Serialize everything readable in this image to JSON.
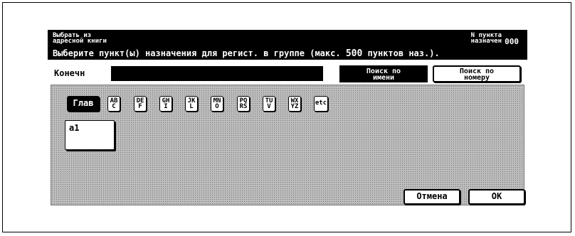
{
  "header": {
    "title_line1": "Выбрать из",
    "title_line2": "адресной книги",
    "count_line1": "N пункта",
    "count_line2": "назначен",
    "count_value": "000",
    "message_prefix": "Выберите пункт(ы) назначения для регист. в группе (макс. ",
    "message_max": "500",
    "message_suffix": " пунктов наз.)."
  },
  "destination": {
    "label": "Конечн",
    "value": ""
  },
  "search": {
    "by_name_line1": "Поиск по",
    "by_name_line2": "имени",
    "by_number_line1": "Поиск по",
    "by_number_line2": "номеру"
  },
  "index_tabs": [
    {
      "line1": "Глав",
      "line2": ""
    },
    {
      "line1": "AB",
      "line2": "C"
    },
    {
      "line1": "DE",
      "line2": "F"
    },
    {
      "line1": "GH",
      "line2": "I"
    },
    {
      "line1": "JK",
      "line2": "L"
    },
    {
      "line1": "MN",
      "line2": "O"
    },
    {
      "line1": "PQ",
      "line2": "RS"
    },
    {
      "line1": "TU",
      "line2": "V"
    },
    {
      "line1": "WX",
      "line2": "YZ"
    },
    {
      "line1": "etc",
      "line2": ""
    }
  ],
  "entries": [
    {
      "label": "a1"
    }
  ],
  "actions": {
    "cancel": "Отмена",
    "ok": "OK"
  }
}
